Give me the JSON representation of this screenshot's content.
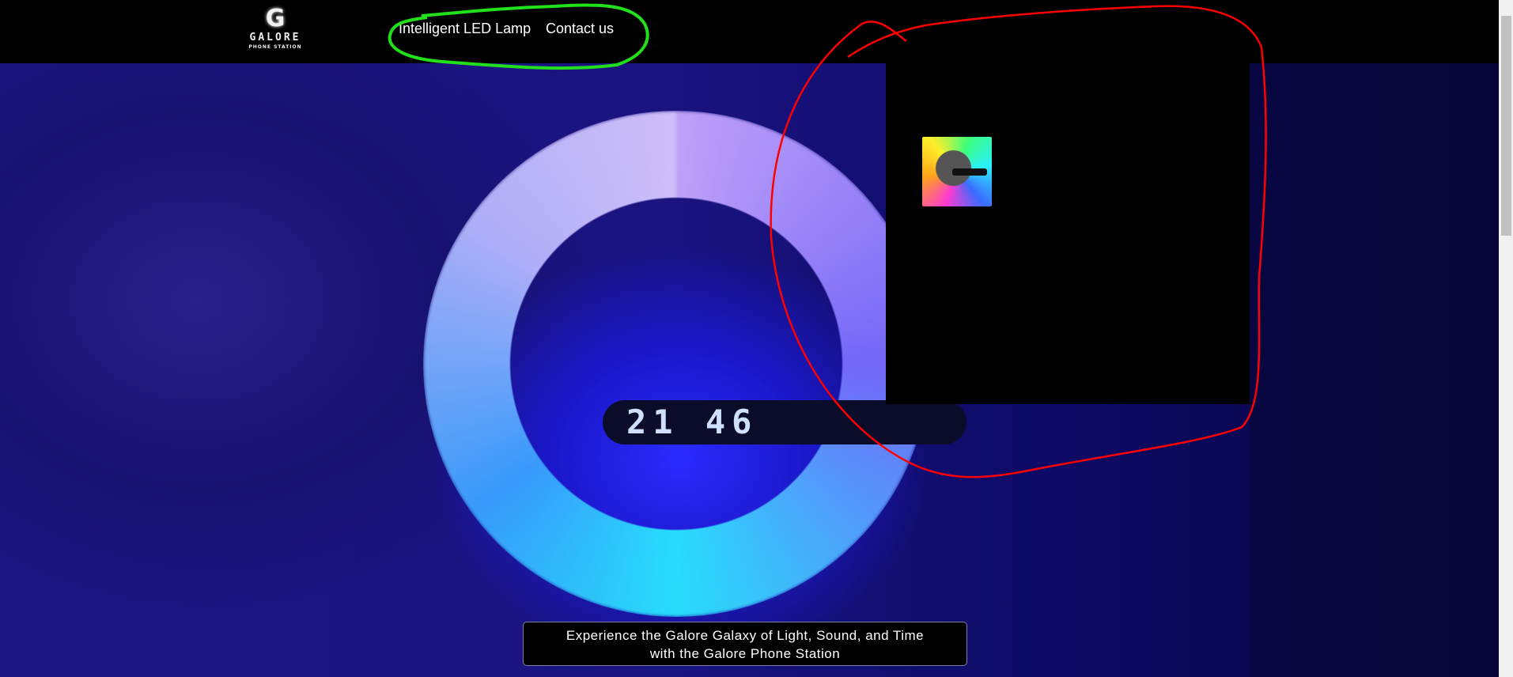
{
  "brand": {
    "initial": "G",
    "name": "GALORE",
    "tagline": "PHONE STATION"
  },
  "nav": {
    "items": [
      {
        "label": "Intelligent LED Lamp"
      },
      {
        "label": "Contact us"
      }
    ]
  },
  "hero": {
    "clock_display": "21 46",
    "caption_line1": "Experience the Galore Galaxy of Light, Sound, and Time",
    "caption_line2": "with the Galore Phone Station"
  },
  "colors": {
    "annotation_green": "#22e01a",
    "annotation_red": "#ff0000",
    "navbar": "#000000"
  }
}
